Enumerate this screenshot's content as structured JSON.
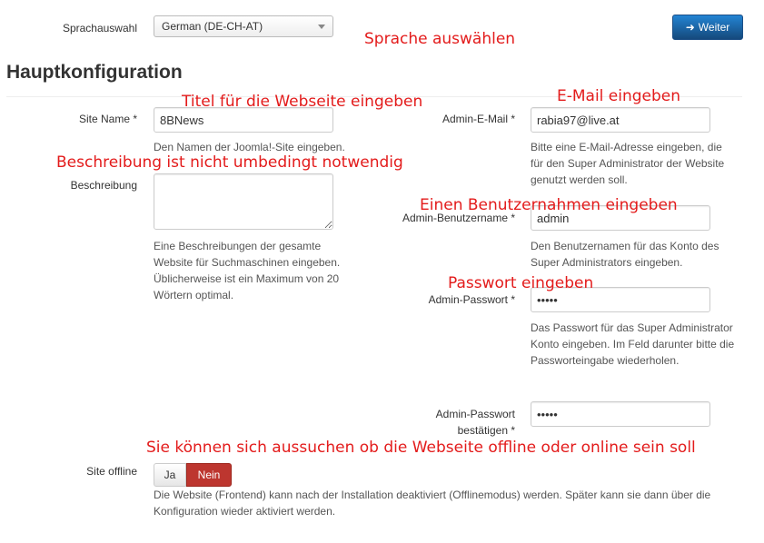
{
  "language": {
    "label": "Sprachauswahl",
    "selected": "German (DE-CH-AT)",
    "next_button": "Weiter"
  },
  "section_title": "Hauptkonfiguration",
  "fields": {
    "site_name": {
      "label": "Site Name *",
      "value": "8BNews",
      "help": "Den Namen der Joomla!-Site eingeben."
    },
    "description": {
      "label": "Beschreibung",
      "value": "",
      "help": "Eine Beschreibungen der gesamte Website für Suchmaschinen eingeben. Üblicherweise ist ein Maximum von 20 Wörtern optimal."
    },
    "admin_email": {
      "label": "Admin-E-Mail *",
      "value": "rabia97@live.at",
      "help": "Bitte eine E-Mail-Adresse eingeben, die für den Super Administrator der Website genutzt werden soll."
    },
    "admin_username": {
      "label": "Admin-Benutzername *",
      "value": "admin",
      "help": "Den Benutzernamen für das Konto des Super Administrators eingeben."
    },
    "admin_password": {
      "label": "Admin-Passwort *",
      "value": "•••••",
      "help": "Das Passwort für das Super Administrator Konto eingeben. Im Feld darunter bitte die Passworteingabe wiederholen."
    },
    "admin_password_confirm": {
      "label": "Admin-Passwort bestätigen *",
      "value": "•••••"
    },
    "site_offline": {
      "label": "Site offline",
      "option_yes": "Ja",
      "option_no": "Nein",
      "selected": "Nein",
      "help": "Die Website (Frontend) kann nach der Installation deaktiviert (Offlinemodus) werden. Später kann sie dann über die Konfiguration wieder aktiviert werden."
    }
  },
  "annotations": {
    "language": "Sprache auswählen",
    "title": "Titel für die Webseite eingeben",
    "email": "E-Mail eingeben",
    "description": "Beschreibung ist nicht umbedingt notwendig",
    "username": "Einen Benutzernahmen eingeben",
    "password": "Passwort eingeben",
    "offline": "Sie können sich aussuchen ob die Webseite offline oder online sein soll"
  },
  "colors": {
    "annotation": "#e31b1b",
    "primary": "#1d6fb8",
    "danger": "#bd362f"
  }
}
